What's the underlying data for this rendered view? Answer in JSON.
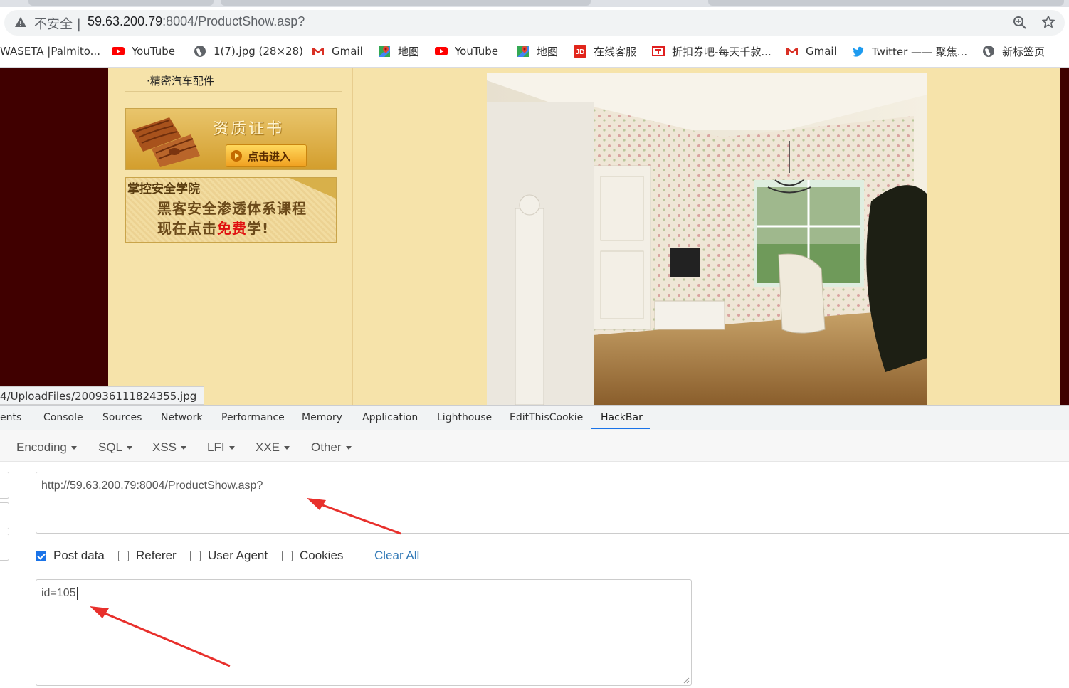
{
  "browser": {
    "insecure_label": "不安全 |",
    "url_host": "59.63.200.79",
    "url_rest": ":8004/ProductShow.asp?",
    "bookmarks": [
      {
        "label": "WASETA |Palmito...",
        "icon": "none"
      },
      {
        "label": "YouTube",
        "icon": "youtube-icon"
      },
      {
        "label": "1(7).jpg (28×28)",
        "icon": "globe-icon"
      },
      {
        "label": "Gmail",
        "icon": "gmail-icon"
      },
      {
        "label": "地图",
        "icon": "maps-icon"
      },
      {
        "label": "YouTube",
        "icon": "youtube-icon"
      },
      {
        "label": "地图",
        "icon": "maps-icon"
      },
      {
        "label": "在线客服",
        "icon": "jd-icon"
      },
      {
        "label": "折扣券吧-每天千款...",
        "icon": "coupon-icon"
      },
      {
        "label": "Gmail",
        "icon": "gmail-icon"
      },
      {
        "label": "Twitter —— 聚焦...",
        "icon": "twitter-icon"
      },
      {
        "label": "新标签页",
        "icon": "globe-icon"
      }
    ]
  },
  "page": {
    "category_item": "·精密汽车配件",
    "cert_banner": {
      "title": "资质证书",
      "button": "点击进入"
    },
    "academy_banner": {
      "title": "掌控安全学院",
      "line1": "黑客安全渗透体系课程",
      "line2_prefix": "现在点击",
      "line2_free": "免费",
      "line2_suffix": "学!"
    },
    "status_url": "4/UploadFiles/200936111824355.jpg"
  },
  "devtools": {
    "tabs": [
      "ents",
      "Console",
      "Sources",
      "Network",
      "Performance",
      "Memory",
      "Application",
      "Lighthouse",
      "EditThisCookie",
      "HackBar"
    ],
    "active_tab": "HackBar"
  },
  "hackbar": {
    "menus": [
      "Encoding",
      "SQL",
      "XSS",
      "LFI",
      "XXE",
      "Other"
    ],
    "url_value": "http://59.63.200.79:8004/ProductShow.asp?",
    "options": [
      {
        "label": "Post data",
        "checked": true
      },
      {
        "label": "Referer",
        "checked": false
      },
      {
        "label": "User Agent",
        "checked": false
      },
      {
        "label": "Cookies",
        "checked": false
      }
    ],
    "clear_all": "Clear All",
    "post_value": "id=105"
  },
  "colors": {
    "page_bg": "#f6e3aa",
    "dark_border": "#400000",
    "active_tab_underline": "#1a73e8",
    "link_blue": "#337ab7",
    "annotation_red": "#e8302c"
  }
}
